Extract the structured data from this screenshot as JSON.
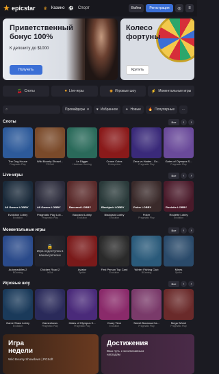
{
  "header": {
    "logo": "epicstar",
    "nav": [
      {
        "label": "Казино",
        "icon": "crown-icon"
      },
      {
        "label": "Спорт",
        "icon": "ball-icon"
      }
    ],
    "login": "Войти",
    "register": "Регистрация"
  },
  "banners": [
    {
      "title": "Приветственный бонус 100%",
      "subtitle": "К депозиту до $1000",
      "cta": "Получить"
    },
    {
      "title": "Колесо фортуны",
      "cta": "Крутить"
    }
  ],
  "categories": [
    {
      "label": "Слоты",
      "icon": "cherries-icon"
    },
    {
      "label": "Live-игры",
      "icon": "live-icon"
    },
    {
      "label": "Игровые шоу",
      "icon": "wheel-icon"
    },
    {
      "label": "Моментальные игры",
      "icon": "lightning-icon"
    }
  ],
  "filters": {
    "search_placeholder": "",
    "providers": "Провайдеры",
    "favorites": "Избранное",
    "new": "Новые",
    "popular": "Популярные"
  },
  "sections": [
    {
      "title": "Слоты",
      "all": "Все",
      "games": [
        {
          "name": "The Dog House",
          "provider": "Pragmatic Play",
          "color": "#2d5a9a"
        },
        {
          "name": "Wild Bounty Showd...",
          "provider": "PGSoft",
          "color": "#7a4a2a"
        },
        {
          "name": "Le Digger",
          "provider": "Hacksaw Gaming",
          "color": "#2a6a5a"
        },
        {
          "name": "Crown Coins",
          "provider": "Endorphina",
          "color": "#8a1a1a"
        },
        {
          "name": "Zeus vs Hades - Go...",
          "provider": "Pragmatic Play",
          "color": "#3a2a7a"
        },
        {
          "name": "Gates of Olympus S...",
          "provider": "Pragmatic Play",
          "color": "#6a4a9a"
        }
      ]
    },
    {
      "title": "Live-игры",
      "all": "Все",
      "games": [
        {
          "name": "Evolution Lobby",
          "provider": "Evolution",
          "color": "#1a2a3a",
          "label": "All Games LOBBY"
        },
        {
          "name": "Pragmatic Play Lob...",
          "provider": "Pragmatic Play",
          "color": "#2a2a3a",
          "label": "All Games LOBBY"
        },
        {
          "name": "Baccarat Lobby",
          "provider": "Evolution",
          "color": "#5a2a2a",
          "label": "Baccarat LOBBY"
        },
        {
          "name": "Blackjack Lobby",
          "provider": "Evolution",
          "color": "#2a3a3a",
          "label": "Blackjack LOBBY"
        },
        {
          "name": "Poker",
          "provider": "Pragmatic Play",
          "color": "#3a2a2a",
          "label": "Poker LOBBY"
        },
        {
          "name": "Roulette Lobby",
          "provider": "Evolution",
          "color": "#4a1a2a",
          "label": "Roulette LOBBY"
        }
      ]
    },
    {
      "title": "Моментальные игры",
      "all": "Все",
      "games": [
        {
          "name": "Automaddles 2",
          "provider": "BGaming",
          "color": "#2a4a8a"
        },
        {
          "name": "Chicken Road 2",
          "provider": "InOut",
          "color": "#3a3a44",
          "locked": "Игра недоступна в вашем регионе"
        },
        {
          "name": "Aviator",
          "provider": "Spribe",
          "color": "#7a1a1a"
        },
        {
          "name": "First Person Top Card",
          "provider": "Evolution",
          "color": "#2a2a2a"
        },
        {
          "name": "Winter Fishing Club",
          "provider": "BGaming",
          "color": "#2a5a7a"
        },
        {
          "name": "Mines",
          "provider": "Spribe",
          "color": "#2a4a6a"
        }
      ]
    },
    {
      "title": "Игровые шоу",
      "all": "Все",
      "games": [
        {
          "name": "Game Shaw Lobby",
          "provider": "Evolution",
          "color": "#1a3a5a"
        },
        {
          "name": "Gameshows",
          "provider": "Pragmatic Play",
          "color": "#2a2a5a"
        },
        {
          "name": "Gates of Olympus X...",
          "provider": "Pragmatic Play",
          "color": "#4a2a7a"
        },
        {
          "name": "Crazy Time",
          "provider": "Evolution",
          "color": "#8a2a6a"
        },
        {
          "name": "Sweet Bonanza Ca...",
          "provider": "Pragmatic Play",
          "color": "#7a3a6a"
        },
        {
          "name": "Mega Wheel",
          "provider": "Pragmatic Play",
          "color": "#6a2a2a"
        }
      ]
    }
  ],
  "promos": [
    {
      "title": "Игра недели",
      "subtitle": "Wild Bounty Showdown | PGSoft"
    },
    {
      "title": "Достижения",
      "subtitle": "Ваш путь к эксклюзивным наградам"
    }
  ]
}
